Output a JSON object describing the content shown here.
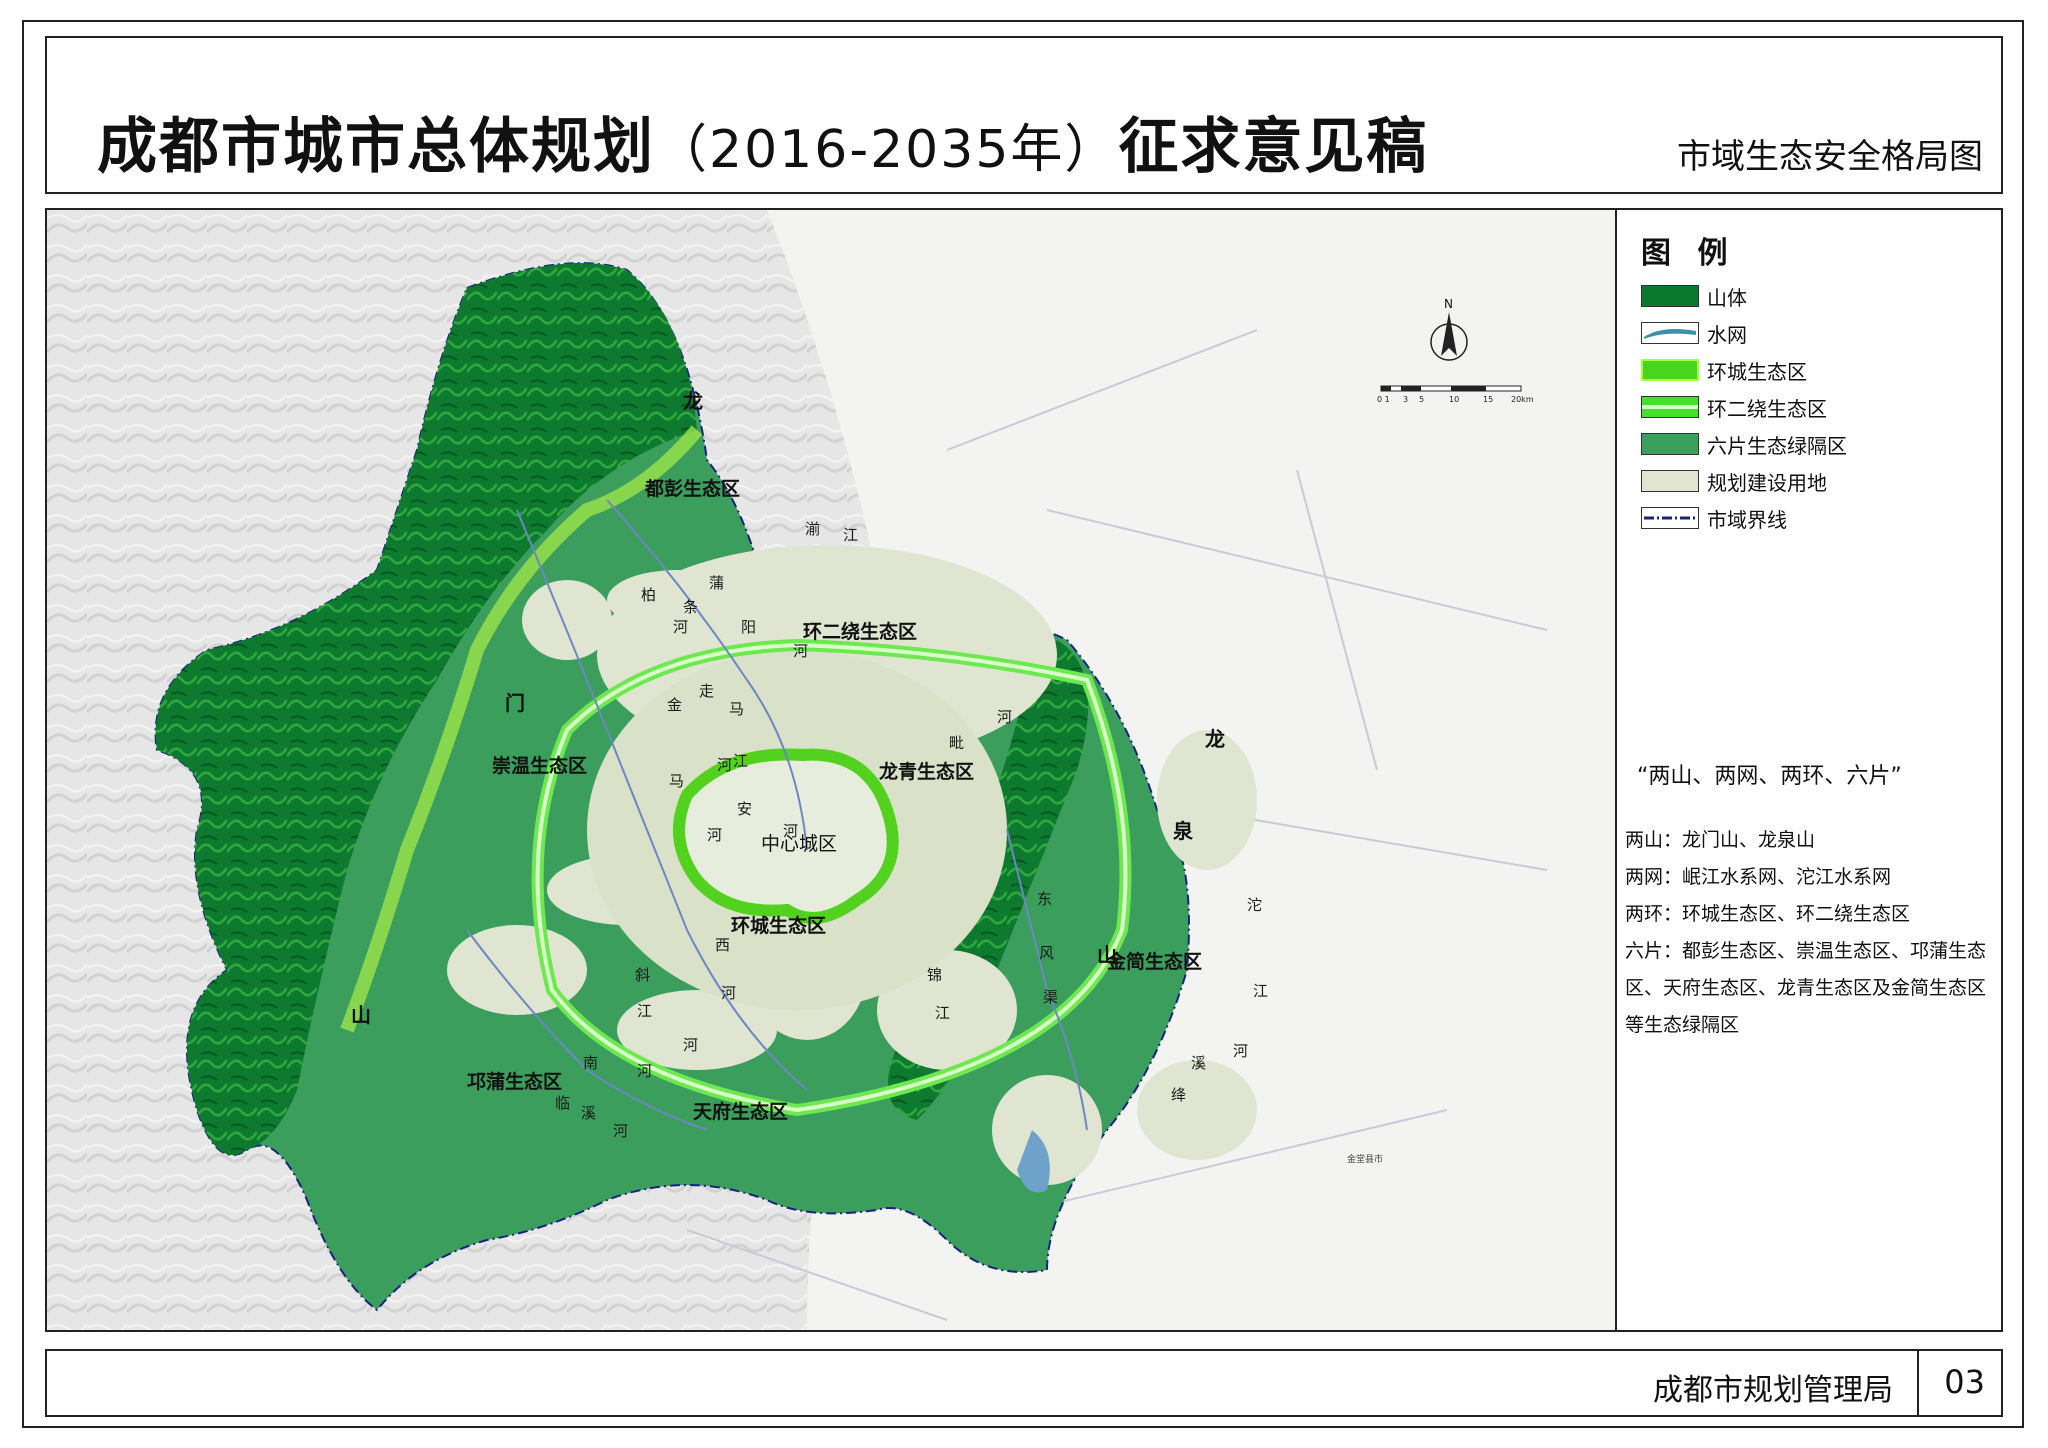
{
  "header": {
    "title_main": "成都市城市总体规划",
    "title_years": "（2016-2035年）",
    "title_tail": "征求意见稿",
    "subtitle": "市域生态安全格局图"
  },
  "legend": {
    "title": "图 例",
    "items": [
      {
        "label": "山体",
        "color": "#0b7a2e"
      },
      {
        "label": "水网",
        "color": "#3f8fa8"
      },
      {
        "label": "环城生态区",
        "color": "#48d51e"
      },
      {
        "label": "环二绕生态区",
        "color": "#45e02a"
      },
      {
        "label": "六片生态绿隔区",
        "color": "#3aa05c"
      },
      {
        "label": "规划建设用地",
        "color": "#dfe5d0"
      },
      {
        "label": "市域界线",
        "color": "#1a237e"
      }
    ],
    "summary_head": "“两山、两网、两环、六片”",
    "summary_lines": [
      "两山：龙门山、龙泉山",
      "两网：岷江水系网、沱江水系网",
      "两环：环城生态区、环二绕生态区",
      "六片：都彭生态区、崇温生态区、邛蒲生态区、天府生态区、龙青生态区及金简生态区等生态绿隔区"
    ]
  },
  "compass": {
    "north": "N",
    "scale_ticks": [
      "0 1",
      "3",
      "5",
      "10",
      "15",
      "20km"
    ]
  },
  "map": {
    "regions": [
      "都彭生态区",
      "崇温生态区",
      "邛蒲生态区",
      "天府生态区",
      "龙青生态区",
      "金简生态区",
      "中心城区",
      "环城生态区",
      "环二绕生态区"
    ],
    "mountain_west": [
      "龙",
      "门",
      "山"
    ],
    "mountain_east": [
      "龙",
      "泉",
      "山"
    ],
    "rivers": [
      "湔",
      "江",
      "蒲",
      "阳",
      "河",
      "柏",
      "条",
      "河",
      "走",
      "马",
      "金",
      "马",
      "河",
      "江",
      "安",
      "河",
      "河",
      "毗",
      "河",
      "东",
      "风",
      "渠",
      "西",
      "河",
      "锦",
      "江",
      "斜",
      "江",
      "河",
      "南",
      "河",
      "临",
      "溪",
      "河",
      "沱",
      "江",
      "绛",
      "溪",
      "河"
    ],
    "city_label": "金堂县市"
  },
  "footer": {
    "org": "成都市规划管理局",
    "page": "03"
  }
}
